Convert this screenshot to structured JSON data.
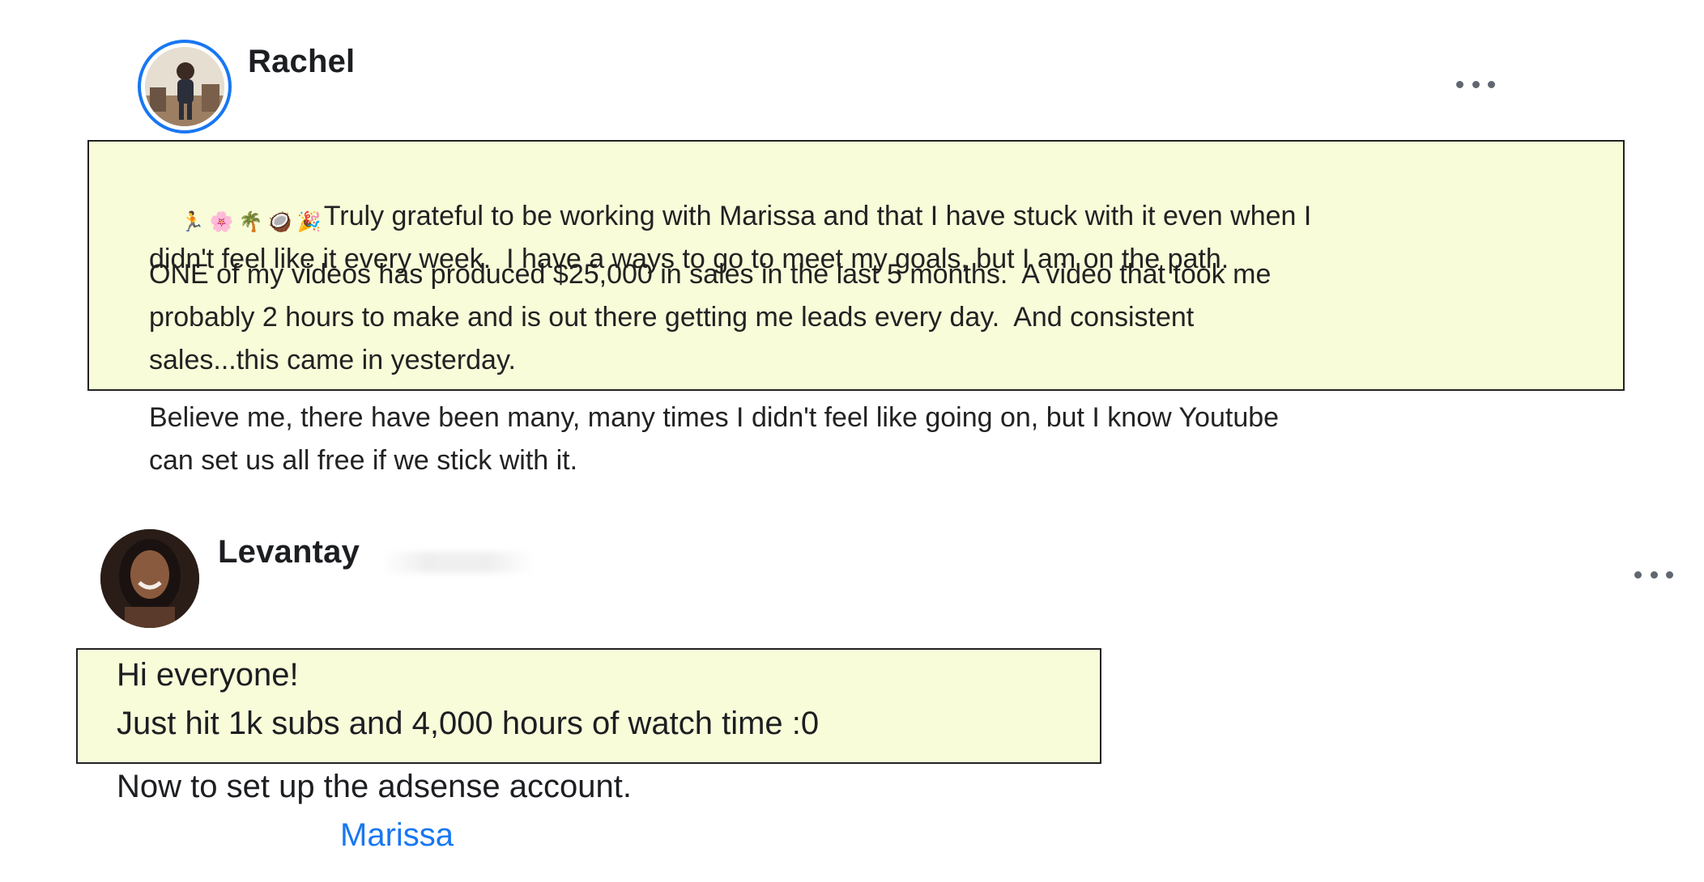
{
  "posts": [
    {
      "author": "Rachel",
      "emojis": [
        "🏃",
        "🌸",
        "🌴",
        "🥥",
        "🎉"
      ],
      "highlighted_paragraphs": [
        "Truly grateful to be working with Marissa and that I have stuck with it even when I\ndidn't feel like it every week.  I have a ways to go to meet my goals, but I am on the path.",
        "ONE of my videos has produced $25,000 in sales in the last 5 months.  A video that took me\nprobably 2 hours to make and is out there getting me leads every day.  And consistent\nsales...this came in yesterday."
      ],
      "paragraphs": [
        "Believe me, there have been many, many times I didn't feel like going on, but I know Youtube\ncan set us all free if we stick with it."
      ],
      "icons": {
        "more": "more-horizontal-icon",
        "avatar": "avatar-photo"
      }
    },
    {
      "author": "Levantay",
      "highlighted_paragraphs": [
        "Hi everyone!\nJust hit 1k subs and 4,000 hours of watch time :0"
      ],
      "paragraphs": [
        "Now to set up the adsense account."
      ],
      "mention": "Marissa",
      "icons": {
        "more": "more-horizontal-icon",
        "avatar": "avatar-photo"
      }
    }
  ],
  "colors": {
    "highlight_bg": "#f8fcd9",
    "link": "#1877f2",
    "ring": "#1877f2",
    "text": "#222222"
  }
}
